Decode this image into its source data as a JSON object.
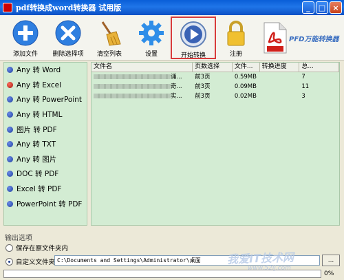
{
  "window": {
    "title": "pdf转换成word转换器 试用版"
  },
  "toolbar": {
    "add_file": "添加文件",
    "delete_selected": "删除选择项",
    "clear_list": "清空列表",
    "settings": "设置",
    "start_convert": "开始转换",
    "register": "注册",
    "brand": "PFD万能转换器"
  },
  "formats": [
    "Any 转 Word",
    "Any 转 Excel",
    "Any 转 PowerPoint",
    "Any 转 HTML",
    "图片 转 PDF",
    "Any 转 TXT",
    "Any 转 图片",
    "DOC 转 PDF",
    "Excel 转 PDF",
    "PowerPoint 转 PDF"
  ],
  "table": {
    "headers": [
      "文件名",
      "页数选择",
      "文件...",
      "转换进度",
      "总..."
    ],
    "rows": [
      {
        "name_tail": "诵...",
        "pages": "前3页",
        "size": "0.59MB",
        "progress": "",
        "total": "7"
      },
      {
        "name_tail": "奇...",
        "pages": "前3页",
        "size": "0.09MB",
        "progress": "",
        "total": "11"
      },
      {
        "name_tail": "实...",
        "pages": "前3页",
        "size": "0.02MB",
        "progress": "",
        "total": "3"
      }
    ]
  },
  "output": {
    "section_title": "输出选项",
    "option_original": "保存在原文件夹内",
    "option_custom": "自定义文件夹",
    "path": "C:\\Documents and Settings\\Administrator\\桌面",
    "browse": "...",
    "progress_pct": "0%",
    "progress_value": 0
  },
  "watermark": {
    "text": "我爱IT技术网",
    "url": "www.52ij.com"
  },
  "colors": {
    "highlight": "#d83b3b",
    "panel": "#d3ecd3",
    "titlebar": "#0a5fd8"
  }
}
